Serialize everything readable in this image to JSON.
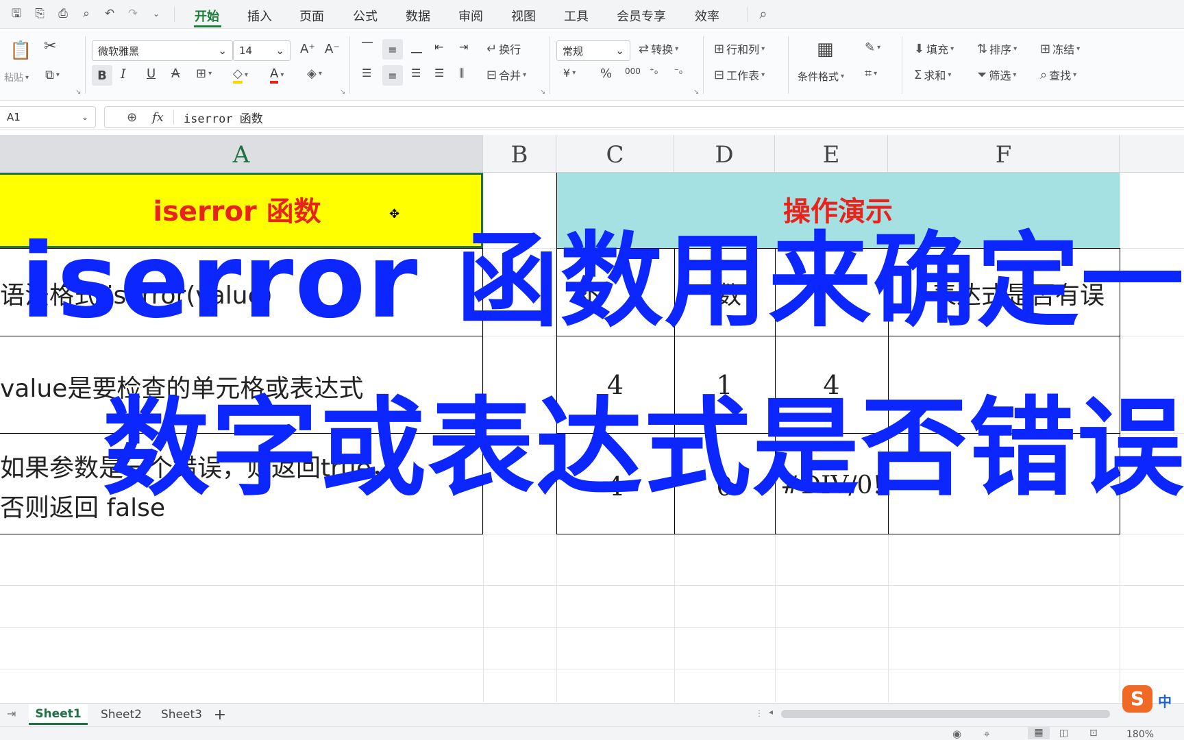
{
  "menubar": {
    "tabs": [
      "开始",
      "插入",
      "页面",
      "公式",
      "数据",
      "审阅",
      "视图",
      "工具",
      "会员专享",
      "效率"
    ],
    "active_tab": "开始"
  },
  "ribbon": {
    "paste_label": "粘贴",
    "font_name": "微软雅黑",
    "font_size": "14",
    "wrap_label": "换行",
    "merge_label": "合并",
    "number_format": "常规",
    "convert_label": "转换",
    "currency_symbol": "¥",
    "percent_symbol": "%",
    "thousands_symbol": "000",
    "rowcol_label": "行和列",
    "worksheet_label": "工作表",
    "cond_format_label": "条件格式",
    "fill_label": "填充",
    "sort_label": "排序",
    "freeze_label": "冻结",
    "sum_label": "求和",
    "filter_label": "筛选",
    "find_label": "查找"
  },
  "formula_bar": {
    "name_box": "A1",
    "fx": "fx",
    "content": "iserror 函数"
  },
  "columns": [
    "A",
    "B",
    "C",
    "D",
    "E",
    "F"
  ],
  "cells": {
    "a1": "iserror 函数",
    "cf1": "操作演示",
    "a2": "语法格式 iserror(value)",
    "b2_partial": "补",
    "d2_partial": "数",
    "f2_partial": "表达式是否有误",
    "a3": "value是要检查的单元格或表达式",
    "c3": "4",
    "d3": "1",
    "e3": "4",
    "a4_line1": "如果参数是一个错误，则返回true，",
    "a4_line2": "否则返回 false",
    "c4_partial": "4",
    "d4_partial": "0",
    "e4": "#DIV/0!"
  },
  "overlay": {
    "line1": "iserror 函数用来确定一个",
    "line2": "数字或表达式是否错误"
  },
  "sheet_tabs": [
    "Sheet1",
    "Sheet2",
    "Sheet3"
  ],
  "active_sheet": "Sheet1",
  "add_sheet": "+",
  "ime": "中",
  "zoom": "180%",
  "colors": {
    "header_yellow": "#ffff00",
    "header_teal": "#a5e0e3",
    "header_text_red": "#e8231c",
    "overlay_blue": "#0b26ff",
    "accent_green": "#1a7f37"
  }
}
